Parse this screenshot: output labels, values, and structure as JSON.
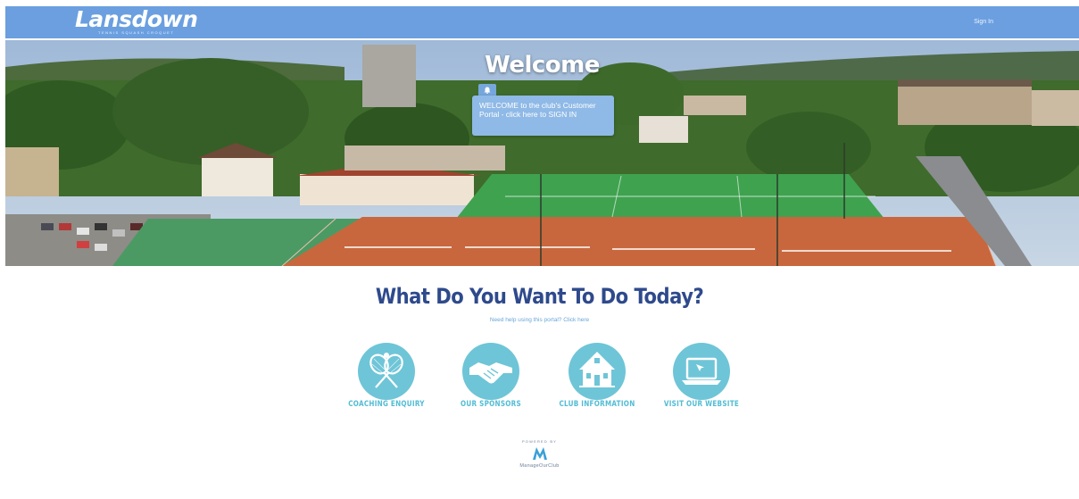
{
  "header": {
    "logo_text": "Lansdown",
    "logo_sub": "TENNIS  SQUASH  CROQUET",
    "sign_in_label": "Sign In"
  },
  "hero": {
    "title": "Welcome",
    "welcome_message": "WELCOME to the club's Customer Portal - click here to SIGN IN"
  },
  "main": {
    "title": "What Do You Want To Do Today?",
    "help_link": "Need help using this portal? Click here",
    "actions": [
      {
        "label": "COACHING ENQUIRY",
        "icon": "tennis-rackets-icon"
      },
      {
        "label": "OUR SPONSORS",
        "icon": "handshake-icon"
      },
      {
        "label": "CLUB INFORMATION",
        "icon": "clubhouse-icon"
      },
      {
        "label": "VISIT OUR WEBSITE",
        "icon": "laptop-icon"
      }
    ]
  },
  "footer": {
    "powered_by": "POWERED BY",
    "brand": "ManageOurClub"
  },
  "colors": {
    "header": "#6b9fe0",
    "title": "#2e4a8c",
    "accent": "#6ec5d7",
    "clay": "#c8673d",
    "grass": "#3fa24f"
  }
}
